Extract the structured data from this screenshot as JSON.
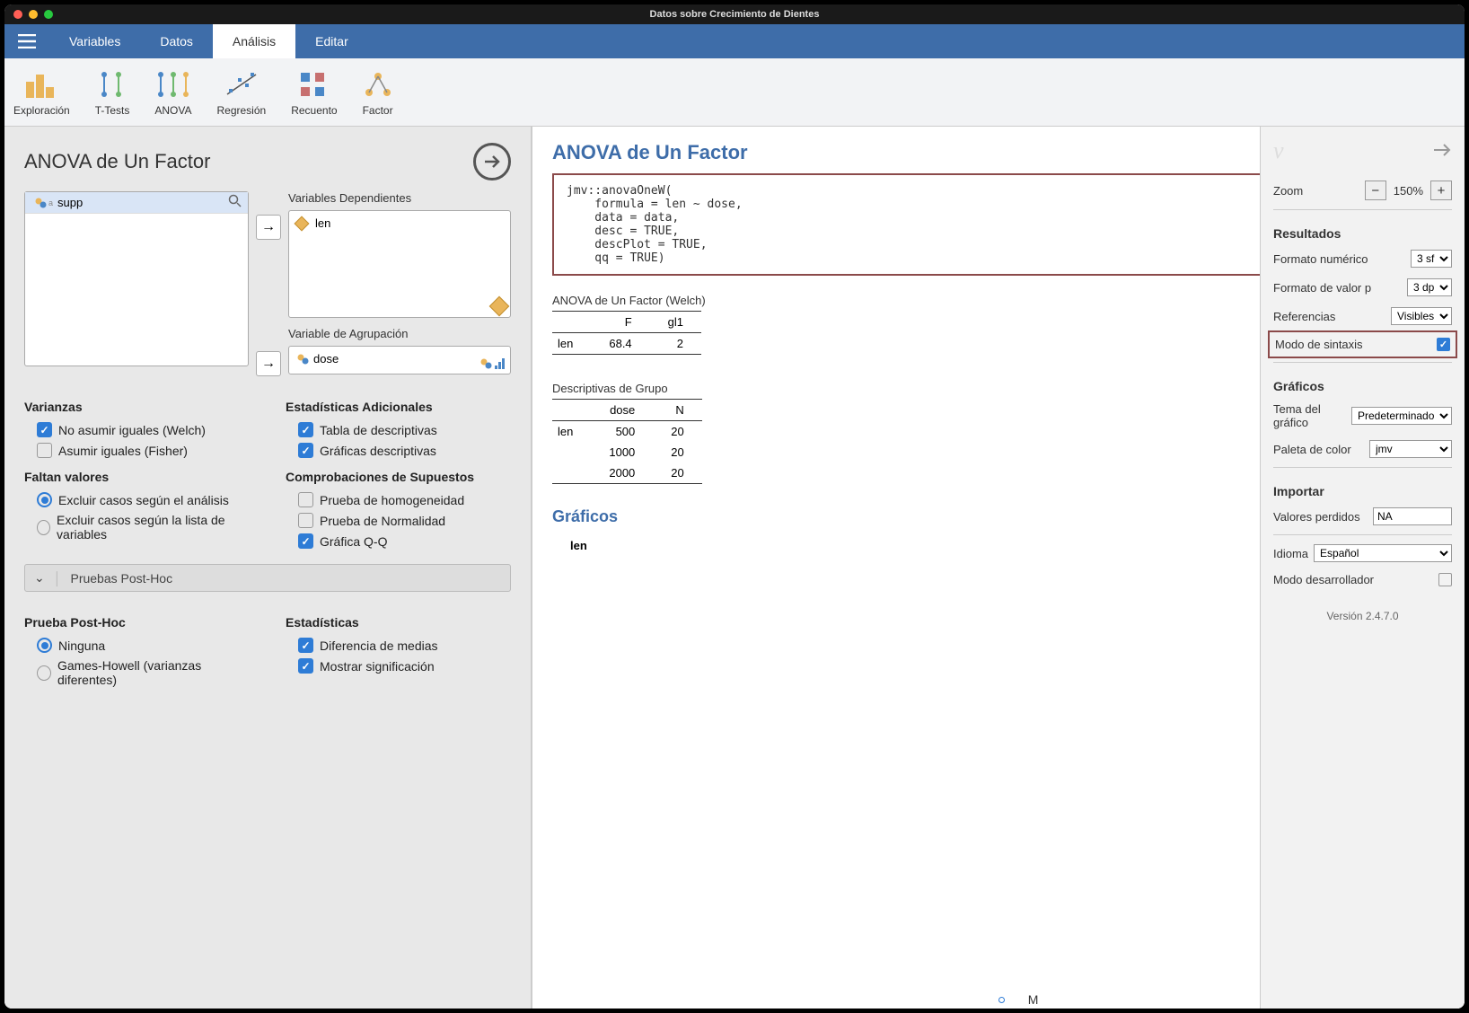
{
  "window": {
    "title": "Datos sobre Crecimiento de Dientes"
  },
  "menu": {
    "items": [
      "Variables",
      "Datos",
      "Análisis",
      "Editar"
    ],
    "active": 2
  },
  "ribbon": {
    "items": [
      {
        "id": "exploracion",
        "label": "Exploración"
      },
      {
        "id": "ttests",
        "label": "T-Tests"
      },
      {
        "id": "anova",
        "label": "ANOVA"
      },
      {
        "id": "regresion",
        "label": "Regresión"
      },
      {
        "id": "recuento",
        "label": "Recuento"
      },
      {
        "id": "factor",
        "label": "Factor"
      }
    ]
  },
  "options": {
    "title": "ANOVA de Un Factor",
    "source_var": "supp",
    "dep_label": "Variables Dependientes",
    "dep_var": "len",
    "group_label": "Variable de Agrupación",
    "group_var": "dose",
    "variances": {
      "heading": "Varianzas",
      "welch": "No asumir iguales (Welch)",
      "fisher": "Asumir iguales (Fisher)"
    },
    "missing": {
      "heading": "Faltan valores",
      "per_analysis": "Excluir casos según el análisis",
      "listwise": "Excluir casos según la lista de variables"
    },
    "addstats": {
      "heading": "Estadísticas Adicionales",
      "desc_table": "Tabla de descriptivas",
      "desc_plot": "Gráficas descriptivas"
    },
    "assump": {
      "heading": "Comprobaciones de Supuestos",
      "homog": "Prueba de homogeneidad",
      "norm": "Prueba de Normalidad",
      "qq": "Gráfica Q-Q"
    },
    "posthoc_section": "Pruebas Post-Hoc",
    "posthoc": {
      "heading": "Prueba Post-Hoc",
      "none": "Ninguna",
      "gh": "Games-Howell (varianzas diferentes)"
    },
    "stats": {
      "heading": "Estadísticas",
      "meandiff": "Diferencia de medias",
      "sig": "Mostrar significación"
    }
  },
  "results": {
    "title": "ANOVA de Un Factor",
    "code": "jmv::anovaOneW(\n    formula = len ~ dose,\n    data = data,\n    desc = TRUE,\n    descPlot = TRUE,\n    qq = TRUE)",
    "anova_table": {
      "title": "ANOVA de Un Factor (Welch)",
      "headers": [
        "",
        "F",
        "gl1"
      ],
      "row": [
        "len",
        "68.4",
        "2"
      ]
    },
    "desc_table": {
      "title": "Descriptivas de Grupo",
      "headers": [
        "",
        "dose",
        "N"
      ],
      "rows": [
        [
          "len",
          "500",
          "20"
        ],
        [
          "",
          "1000",
          "20"
        ],
        [
          "",
          "2000",
          "20"
        ]
      ]
    },
    "plots_heading": "Gráficos",
    "plot_var": "len",
    "connector_label": "M"
  },
  "sidebar": {
    "zoom": {
      "label": "Zoom",
      "value": "150%"
    },
    "results": {
      "heading": "Resultados",
      "numfmt": {
        "label": "Formato numérico",
        "value": "3 sf"
      },
      "pfmt": {
        "label": "Formato de valor p",
        "value": "3 dp"
      },
      "refs": {
        "label": "Referencias",
        "value": "Visibles"
      },
      "syntax": {
        "label": "Modo de sintaxis"
      }
    },
    "plots": {
      "heading": "Gráficos",
      "theme": {
        "label": "Tema del gráfico",
        "value": "Predeterminado"
      },
      "palette": {
        "label": "Paleta de color",
        "value": "jmv"
      }
    },
    "import": {
      "heading": "Importar",
      "missing": {
        "label": "Valores perdidos",
        "value": "NA"
      }
    },
    "lang": {
      "label": "Idioma",
      "value": "Español"
    },
    "dev": {
      "label": "Modo desarrollador"
    },
    "version": "Versión 2.4.7.0"
  }
}
